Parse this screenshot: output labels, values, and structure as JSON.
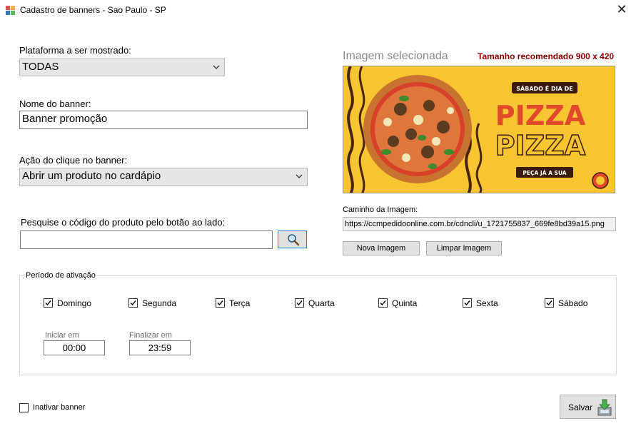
{
  "window": {
    "title": "Cadastro de banners - Sao Paulo - SP",
    "close_glyph": "✕"
  },
  "form": {
    "platform_label": "Plataforma a ser mostrado:",
    "platform_value": "TODAS",
    "name_label": "Nome do banner:",
    "name_value": "Banner promoção",
    "click_action_label": "Ação do clique no banner:",
    "click_action_value": "Abrir um produto no cardápio",
    "search_label": "Pesquise o código do produto pelo botão ao lado:",
    "search_value": ""
  },
  "image_panel": {
    "title": "Imagem selecionada",
    "recommended_size": "Tamanho recomendado 900 x 420",
    "path_label": "Caminho da Imagem:",
    "path_value": "https://ccmpedidoonline.com.br/cdncli/u_1721755837_669fe8bd39a15.png",
    "new_image_button": "Nova Imagem",
    "clear_image_button": "Limpar Imagem",
    "banner": {
      "tagline": "SÁBADO É DIA DE",
      "headline_1": "PIZZA",
      "headline_2": "PIZZA",
      "cta": "PEÇA JÁ A SUA",
      "colors": {
        "background": "#f7c531",
        "headline": "#e04a2b",
        "dark": "#3b1c0c"
      }
    }
  },
  "activation": {
    "group_title": "Período de ativação",
    "days": [
      {
        "label": "Domingo",
        "checked": true
      },
      {
        "label": "Segunda",
        "checked": true
      },
      {
        "label": "Terça",
        "checked": true
      },
      {
        "label": "Quarta",
        "checked": true
      },
      {
        "label": "Quinta",
        "checked": true
      },
      {
        "label": "Sexta",
        "checked": true
      },
      {
        "label": "Sábado",
        "checked": true
      }
    ],
    "start_label": "Iniciar em",
    "start_value": "00:00",
    "end_label": "Finalizar em",
    "end_value": "23:59"
  },
  "footer": {
    "inactivate_label": "Inativar banner",
    "inactivate_checked": false,
    "save_button": "Salvar"
  },
  "icons": {
    "app": "app-window-icon",
    "search": "magnifier-icon",
    "dropdown": "chevron-down-icon",
    "save": "save-download-icon"
  }
}
